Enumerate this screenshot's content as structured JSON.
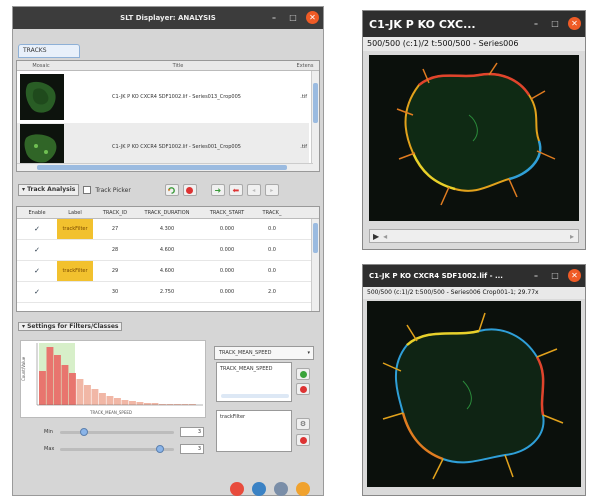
{
  "main_window": {
    "title": "SLT Displayer: ANALYSIS",
    "tab_label": "TRACKS",
    "image_table": {
      "headers": [
        "Mosaic",
        "Title",
        "Extens"
      ],
      "rows": [
        {
          "title": "C1-JK P KO CXCR4 SDF1002.lif - Series013_Crop005",
          "ext": ".tif"
        },
        {
          "title": "C1-JK P KO CXCR4 SDF1002.lif - Series001_Crop005",
          "ext": ".tif"
        }
      ]
    },
    "toolbar": {
      "track_analysis_label": "Track Analysis",
      "track_picker_label": "Track Picker"
    },
    "track_table": {
      "headers": [
        "Enable",
        "Label",
        "TRACK_ID",
        "TRACK_DURATION",
        "TRACK_START",
        "TRACK_"
      ],
      "rows": [
        {
          "enabled": "✓",
          "label": "trackFilter",
          "id": "27",
          "duration": "4.300",
          "start": "0.000",
          "end": "0.0"
        },
        {
          "enabled": "✓",
          "label": "",
          "id": "28",
          "duration": "4.600",
          "start": "0.000",
          "end": "0.0"
        },
        {
          "enabled": "✓",
          "label": "trackFilter",
          "id": "29",
          "duration": "4.600",
          "start": "0.000",
          "end": "0.0"
        },
        {
          "enabled": "✓",
          "label": "",
          "id": "30",
          "duration": "2.750",
          "start": "0.000",
          "end": "2.0"
        }
      ]
    },
    "settings": {
      "header_label": "Settings for Filters/Classes",
      "feature_select": "TRACK_MEAN_SPEED",
      "feature_list_item": "TRACK_MEAN_SPEED",
      "filter_list_item": "trackFilter",
      "histogram_xlabel": "TRACK_MEAN_SPEED",
      "histogram_ylabel": "Count/Value",
      "min_label": "Min",
      "max_label": "Max",
      "min_value": "3",
      "max_value": "3"
    }
  },
  "image_window_1": {
    "title": "C1-JK P KO CXC...",
    "info": "500/500 (c:1)/2 t:500/500 - Series006"
  },
  "image_window_2": {
    "title": "C1-JK P KO CXCR4 SDF1002.lif - ...",
    "info": "500/500 (c:1)/2 t:500/500 - Series006 Crop001-1; 29.77x"
  },
  "colors": {
    "title_bar": "#3c3c3c",
    "close_button": "#ef5b26",
    "label_highlight": "#f2c12e",
    "histogram_bar": "#e8756e",
    "histogram_bar_light": "#f1b7a6",
    "histogram_band": "#d7efc9"
  },
  "icons": [
    "close-icon",
    "minimize-icon",
    "maximize-icon",
    "refresh-icon",
    "stop-icon",
    "add-icon",
    "remove-icon",
    "play-icon"
  ]
}
